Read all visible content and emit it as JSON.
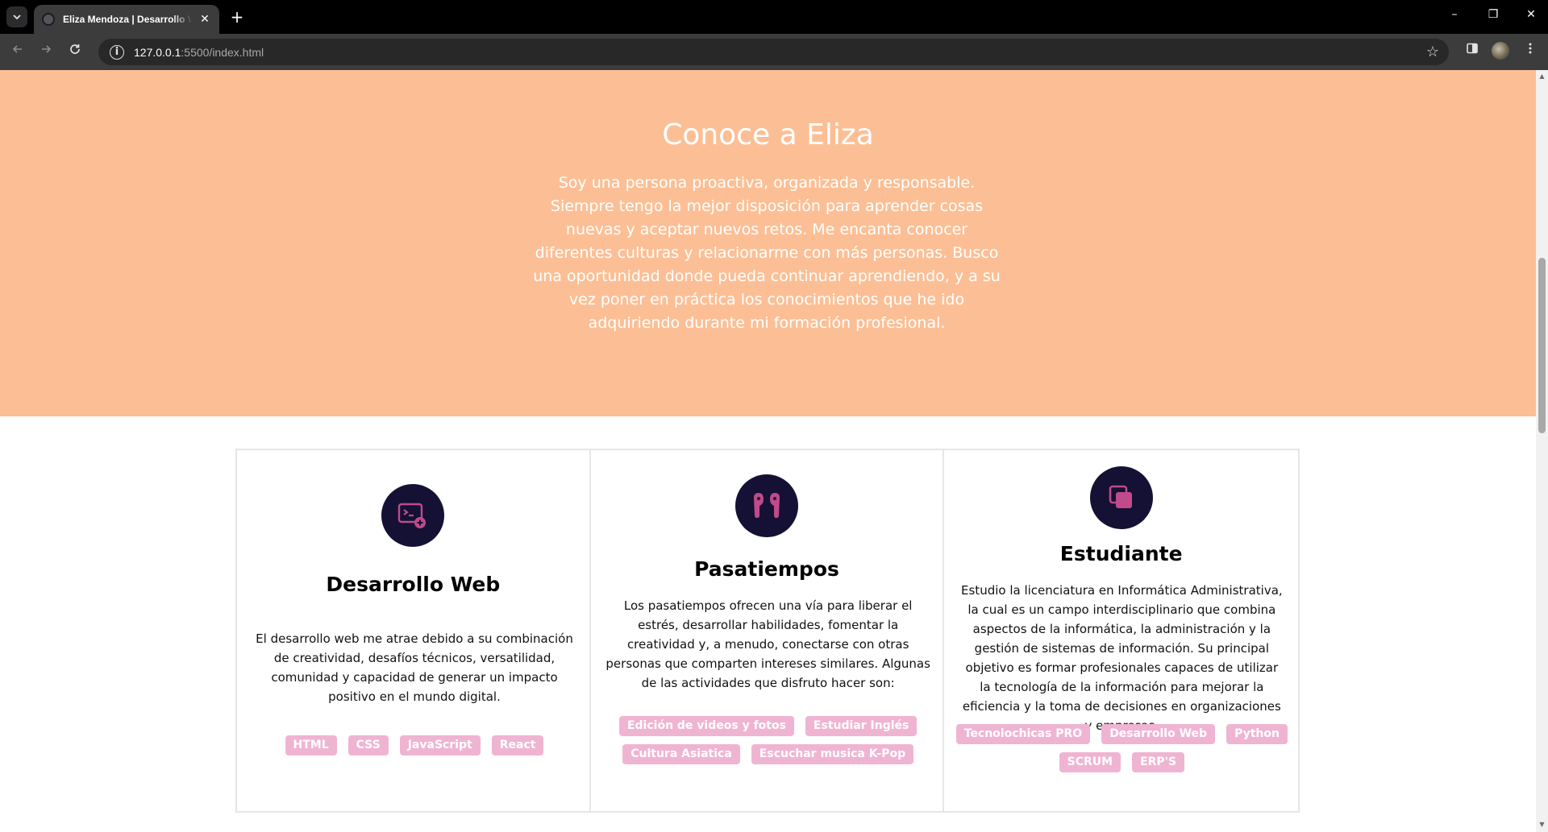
{
  "browser": {
    "tab_title": "Eliza Mendoza | Desarrollo Web",
    "tab_close": "✕",
    "new_tab": "+",
    "url_host": "127.0.0.1",
    "url_rest": ":5500/index.html",
    "win_min": "–",
    "win_max": "❐",
    "win_close": "✕"
  },
  "about": {
    "title": "Conoce a Eliza",
    "text": "Soy una persona proactiva, organizada y responsable. Siempre tengo la mejor disposición para aprender cosas nuevas y aceptar nuevos retos. Me encanta conocer diferentes culturas y relacionarme con más personas. Busco una oportunidad donde pueda continuar aprendiendo, y a su vez poner en práctica los conocimientos que he ido adquiriendo durante mi formación profesional."
  },
  "cards": [
    {
      "icon": "terminal-add-icon",
      "title": "Desarrollo Web",
      "text": "El desarrollo web me atrae debido a su combinación de creatividad, desafíos técnicos, versatilidad, comunidad y capacidad de generar un impacto positivo en el mundo digital.",
      "tags": [
        "HTML",
        "CSS",
        "JavaScript",
        "React"
      ]
    },
    {
      "icon": "earbuds-icon",
      "title": "Pasatiempos",
      "text": "Los pasatiempos ofrecen una vía para liberar el estrés, desarrollar habilidades, fomentar la creatividad y, a menudo, conectarse con otras personas que comparten intereses similares. Algunas de las actividades que disfruto hacer son:",
      "tags": [
        "Edición de videos y fotos",
        "Estudiar Inglés",
        "Cultura Asiatica",
        "Escuchar musica K-Pop"
      ]
    },
    {
      "icon": "copy-icon",
      "title": "Estudiante",
      "text": "Estudio la licenciatura en Informática Administrativa, la cual es un campo interdisciplinario que combina aspectos de la informática, la administración y la gestión de sistemas de información. Su principal objetivo es formar profesionales capaces de utilizar la tecnología de la información para mejorar la eficiencia y la toma de decisiones en organizaciones y empresas.",
      "tags": [
        "Tecnolochicas PRO",
        "Desarrollo Web",
        "Python",
        "SCRUM",
        "ERP'S"
      ]
    }
  ],
  "colors": {
    "about_bg": "#fcbf95",
    "icon_bg": "#141134",
    "icon_accent": "#c04a8a",
    "chip_bg": "#f0b4d3"
  }
}
